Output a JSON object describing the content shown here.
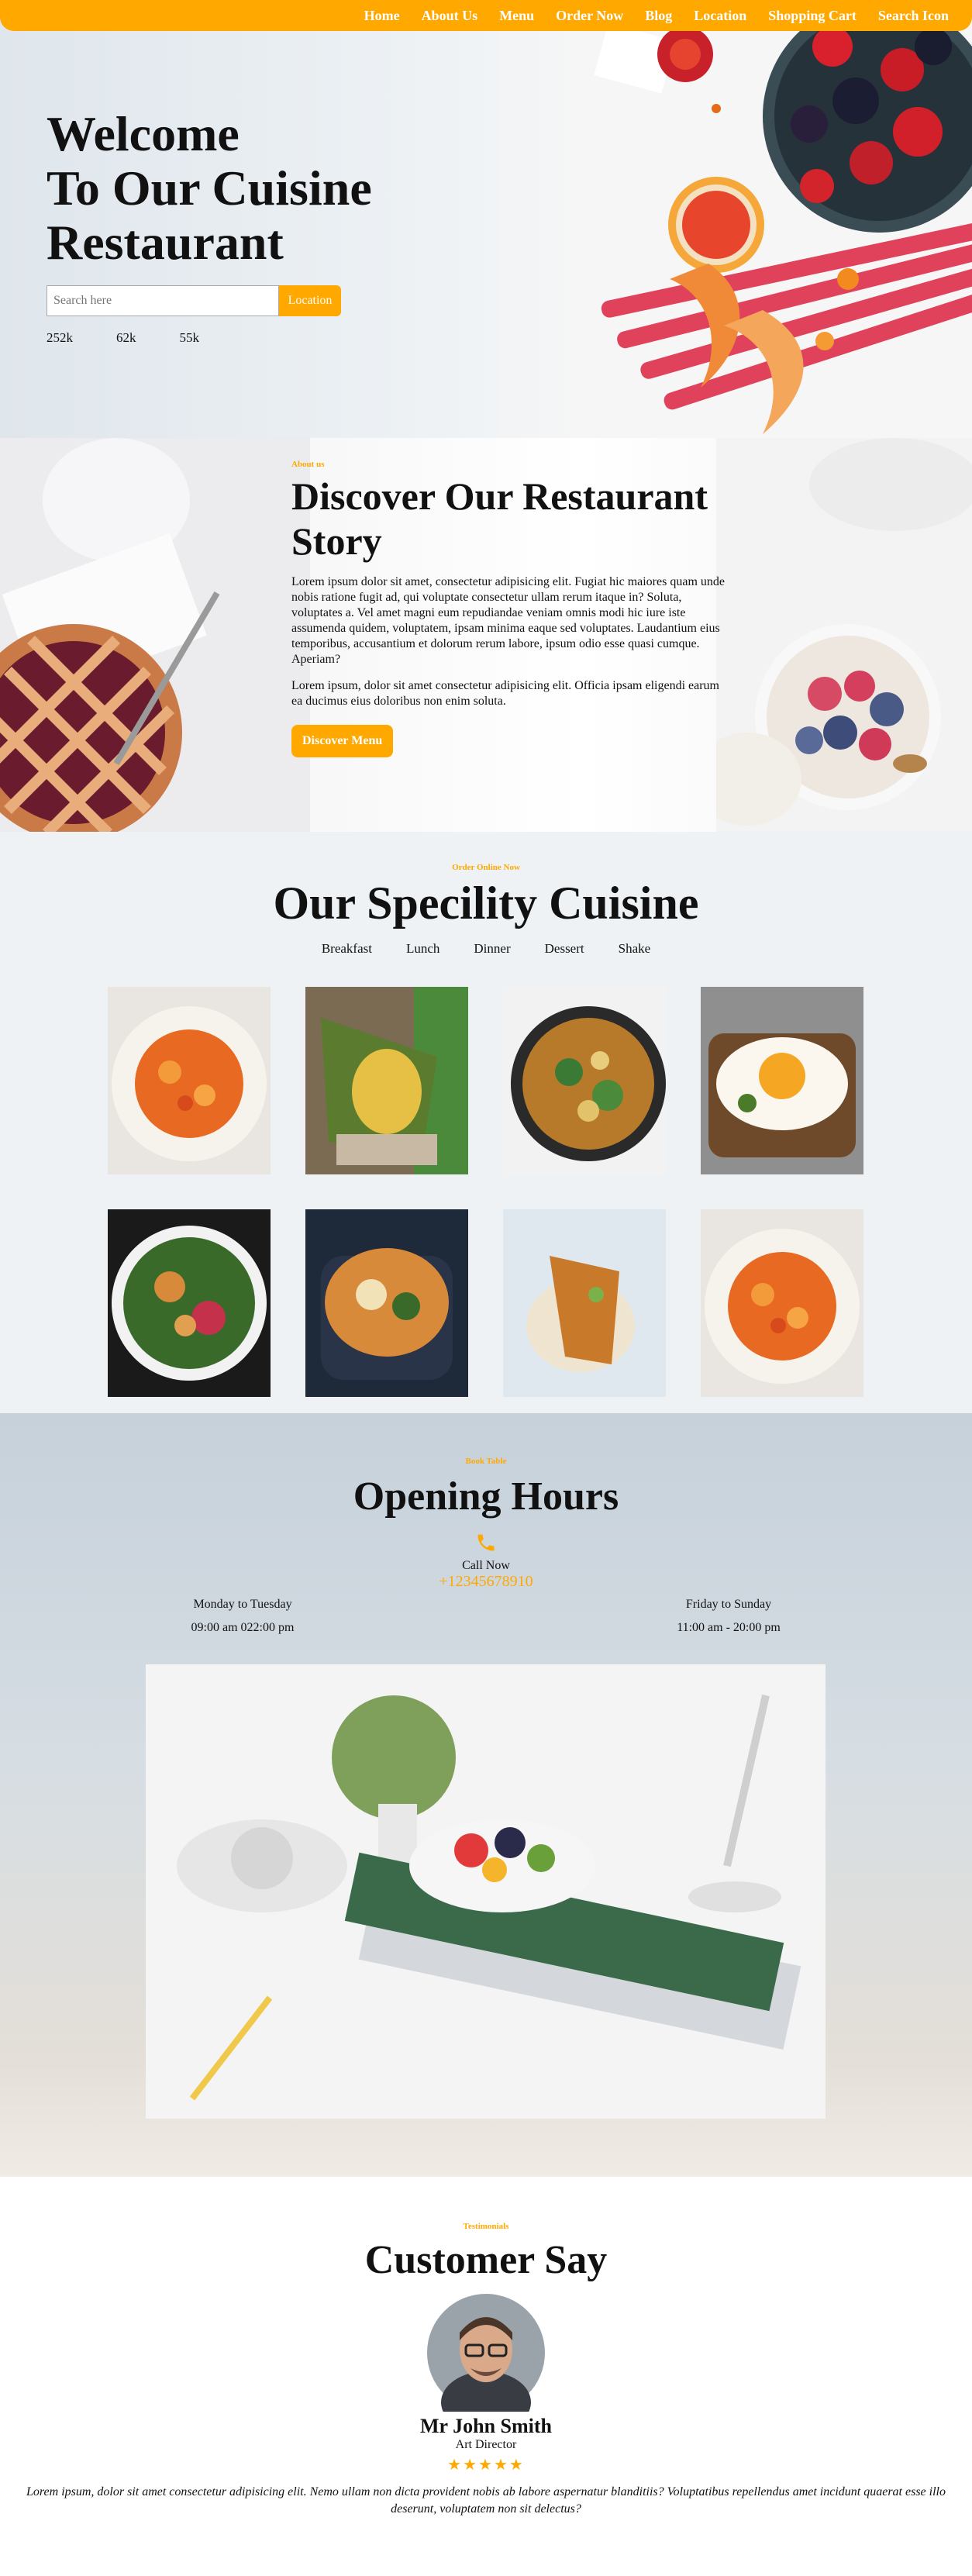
{
  "nav": {
    "items": [
      "Home",
      "About Us",
      "Menu",
      "Order Now",
      "Blog",
      "Location",
      "Shopping Cart",
      "Search Icon"
    ]
  },
  "hero": {
    "title_lines": [
      "Welcome",
      "To Our Cuisine",
      "Restaurant"
    ],
    "search_placeholder": "Search here",
    "location_button": "Location",
    "stats": [
      "252k",
      "62k",
      "55k"
    ]
  },
  "about": {
    "eyebrow": "About us",
    "title": "Discover Our Restaurant Story",
    "paragraph1": "Lorem ipsum dolor sit amet, consectetur adipisicing elit. Fugiat hic maiores quam unde nobis ratione fugit ad, qui voluptate consectetur ullam rerum itaque in? Soluta, voluptates a. Vel amet magni eum repudiandae veniam omnis modi hic iure iste assumenda quidem, voluptatem, ipsam minima eaque sed voluptates. Laudantium eius temporibus, accusantium et dolorum rerum labore, ipsum odio esse quasi cumque. Aperiam?",
    "paragraph2": "Lorem ipsum, dolor sit amet consectetur adipisicing elit. Officia ipsam eligendi earum ea ducimus eius doloribus non enim soluta.",
    "button": "Discover Menu"
  },
  "speciality": {
    "eyebrow": "Order Online Now",
    "title": "Our Specility Cuisine",
    "categories": [
      "Breakfast",
      "Lunch",
      "Dinner",
      "Dessert",
      "Shake"
    ]
  },
  "opening": {
    "eyebrow": "Book Table",
    "title": "Opening Hours",
    "call_label": "Call Now",
    "phone": "+12345678910",
    "left_days": "Monday to Tuesday",
    "left_hours": "09:00 am 022:00 pm",
    "right_days": "Friday to Sunday",
    "right_hours": "11:00 am - 20:00 pm"
  },
  "testimonial": {
    "eyebrow": "Testimonials",
    "title": "Customer Say",
    "name": "Mr John Smith",
    "role": "Art Director",
    "stars": "★★★★★",
    "quote": "Lorem ipsum, dolor sit amet consectetur adipisicing elit. Nemo ullam non dicta provident nobis ab labore aspernatur blanditiis? Voluptatibus repellendus amet incidunt quaerat esse illo deserunt, voluptatem non sit delectus?"
  },
  "colors": {
    "accent": "#ffa800"
  }
}
